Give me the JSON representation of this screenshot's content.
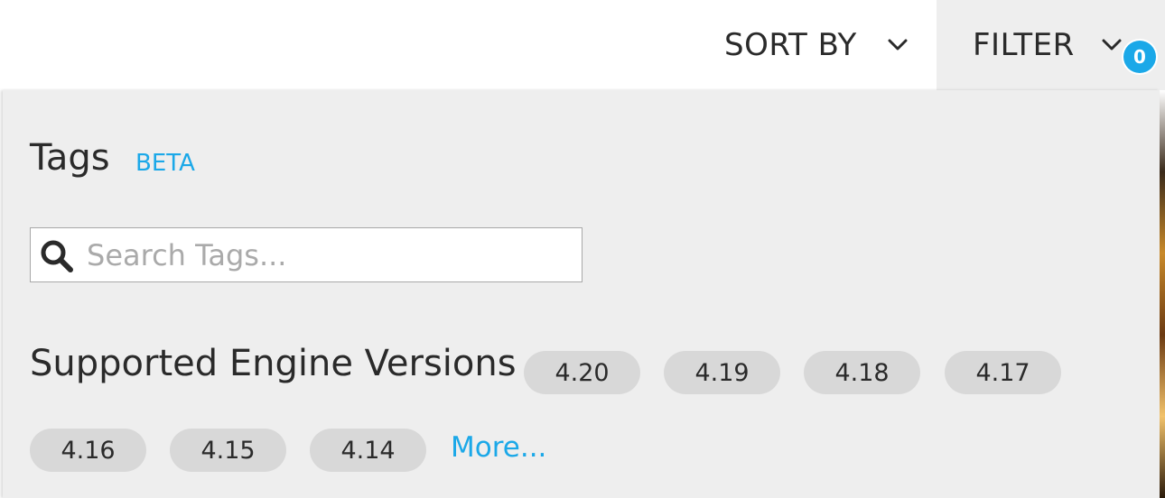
{
  "topbar": {
    "sort_label": "SORT BY",
    "filter_label": "FILTER",
    "filter_count": "0"
  },
  "panel": {
    "title": "Tags",
    "title_badge": "BETA",
    "search_placeholder": "Search Tags...",
    "engine_label": "Supported Engine Versions",
    "versions": [
      "4.20",
      "4.19",
      "4.18",
      "4.17",
      "4.16",
      "4.15",
      "4.14"
    ],
    "more_label": "More..."
  },
  "colors": {
    "accent": "#1ba8e8",
    "panel_bg": "#eeeeee",
    "pill_bg": "#d8d8d8",
    "text": "#2a2a2a"
  },
  "icons": {
    "sort_chevron": "chevron-down-icon",
    "filter_chevron": "chevron-down-icon",
    "search": "search-icon"
  }
}
